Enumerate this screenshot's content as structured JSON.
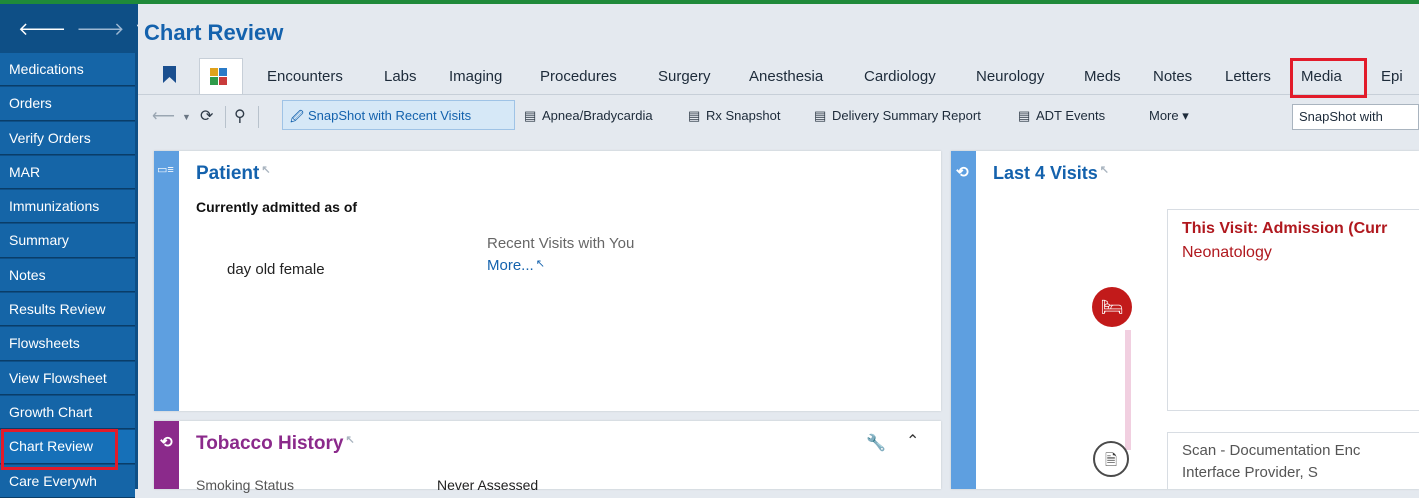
{
  "nav": {
    "back_icon": "arrow-left-icon",
    "forward_icon": "arrow-right-icon",
    "menu_icon": "chevron-down-icon"
  },
  "sidebar": {
    "items": [
      {
        "label": "Medications"
      },
      {
        "label": "Orders"
      },
      {
        "label": "Verify Orders"
      },
      {
        "label": "MAR"
      },
      {
        "label": "Immunizations"
      },
      {
        "label": "Summary"
      },
      {
        "label": "Notes"
      },
      {
        "label": "Results Review"
      },
      {
        "label": "Flowsheets"
      },
      {
        "label": "View Flowsheet"
      },
      {
        "label": "Growth Chart"
      },
      {
        "label": "Chart Review"
      },
      {
        "label": "Care Everywh"
      }
    ],
    "active_item": "Chart Review"
  },
  "header": {
    "title": "Chart Review"
  },
  "tabs": [
    {
      "label": "Encounters"
    },
    {
      "label": "Labs"
    },
    {
      "label": "Imaging"
    },
    {
      "label": "Procedures"
    },
    {
      "label": "Surgery"
    },
    {
      "label": "Anesthesia"
    },
    {
      "label": "Cardiology"
    },
    {
      "label": "Neurology"
    },
    {
      "label": "Meds"
    },
    {
      "label": "Notes"
    },
    {
      "label": "Letters"
    },
    {
      "label": "Media"
    },
    {
      "label": "Epi"
    }
  ],
  "toolbar": {
    "snapshot_recent": "SnapShot with Recent Visits",
    "apnea": "Apnea/Bradycardia",
    "rx_snapshot": "Rx Snapshot",
    "delivery": "Delivery Summary Report",
    "adt": "ADT Events",
    "more": "More ▾",
    "select_value": "SnapShot with"
  },
  "patient_card": {
    "title": "Patient",
    "admitted": "Currently admitted as of",
    "age_sex": "day old female",
    "recent_visits_label": "Recent Visits with You",
    "more_link": "More..."
  },
  "tobacco_card": {
    "title": "Tobacco History",
    "smoking_label": "Smoking Status",
    "smoking_value": "Never Assessed"
  },
  "visits_card": {
    "title": "Last 4 Visits",
    "visit1_title": "This Visit: Admission (Curr",
    "visit1_dept": "Neonatology",
    "visit2_title": "Scan - Documentation Enc",
    "visit2_provider": "Interface Provider, S"
  },
  "colors": {
    "brand_blue": "#1462ad",
    "sidebar": "#0e4f86",
    "highlight_red": "#e21b2a",
    "tobacco_purple": "#8b2a8b",
    "visit_red": "#b0181e"
  }
}
